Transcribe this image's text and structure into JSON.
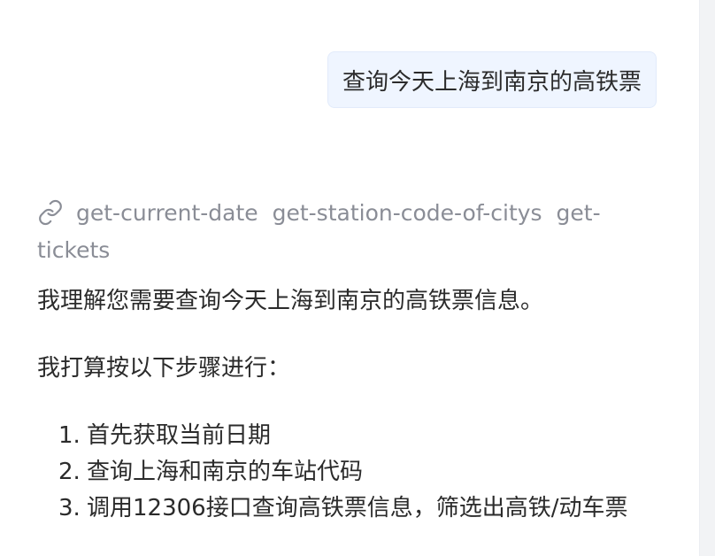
{
  "user_message": {
    "text": "查询今天上海到南京的高铁票"
  },
  "assistant": {
    "tools_icon": "link-icon",
    "tools": [
      "get-current-date",
      "get-station-code-of-citys",
      "get-tickets"
    ],
    "intro": "我理解您需要查询今天上海到南京的高铁票信息。",
    "plan_heading": "我打算按以下步骤进行：",
    "steps": [
      {
        "number": "1.",
        "text": "首先获取当前日期"
      },
      {
        "number": "2.",
        "text": "查询上海和南京的车站代码"
      },
      {
        "number": "3.",
        "text": "调用12306接口查询高铁票信息，筛选出高铁/动车票"
      }
    ]
  },
  "colors": {
    "user_bubble_bg": "#eff5ff",
    "tool_text": "#8a8d96",
    "body_text": "#2b2b2b"
  }
}
